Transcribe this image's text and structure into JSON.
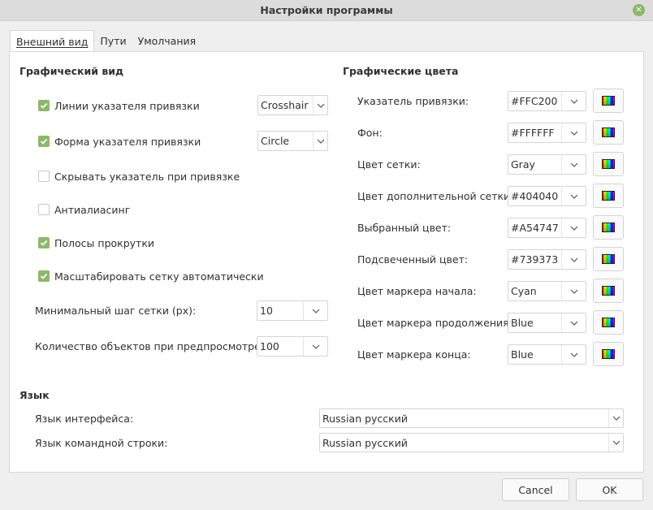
{
  "window": {
    "title": "Настройки программы",
    "close_icon": "close-icon"
  },
  "tabs": [
    {
      "label": "Внешний вид",
      "active": true
    },
    {
      "label": "Пути",
      "active": false
    },
    {
      "label": "Умолчания",
      "active": false
    }
  ],
  "graphic_view": {
    "title": "Графический вид",
    "snap_lines": {
      "label": "Линии указателя привязки",
      "checked": true,
      "value": "Crosshair"
    },
    "snap_shape": {
      "label": "Форма указателя привязки",
      "checked": true,
      "value": "Circle"
    },
    "hide_snap": {
      "label": "Скрывать указатель при привязке",
      "checked": false
    },
    "antialiasing": {
      "label": "Антиалиасинг",
      "checked": false
    },
    "scrollbars": {
      "label": "Полосы прокрутки",
      "checked": true
    },
    "auto_scale_grid": {
      "label": "Масштабировать сетку автоматически",
      "checked": true
    },
    "min_grid_step": {
      "label": "Минимальный шаг сетки (px):",
      "value": "10"
    },
    "preview_count": {
      "label": "Количество объектов при предпросмотре:",
      "value": "100"
    }
  },
  "graphic_colors": {
    "title": "Графические цвета",
    "items": [
      {
        "label": "Указатель привязки:",
        "value": "#FFC200"
      },
      {
        "label": "Фон:",
        "value": "#FFFFFF"
      },
      {
        "label": "Цвет сетки:",
        "value": "Gray"
      },
      {
        "label": "Цвет дополнительной сетки:",
        "value": "#404040"
      },
      {
        "label": "Выбранный цвет:",
        "value": "#A54747"
      },
      {
        "label": "Подсвеченный цвет:",
        "value": "#739373"
      },
      {
        "label": "Цвет маркера начала:",
        "value": "Cyan"
      },
      {
        "label": "Цвет маркера продолжения:",
        "value": "Blue"
      },
      {
        "label": "Цвет маркера конца:",
        "value": "Blue"
      }
    ]
  },
  "language": {
    "title": "Язык",
    "interface": {
      "label": "Язык интерфейса:",
      "value": "Russian русский"
    },
    "command_line": {
      "label": "Язык командной строки:",
      "value": "Russian русский"
    }
  },
  "buttons": {
    "cancel": "Cancel",
    "ok": "OK"
  },
  "colors": {
    "accent_check": "#8cb86a",
    "close_button": "#8cb86a"
  }
}
